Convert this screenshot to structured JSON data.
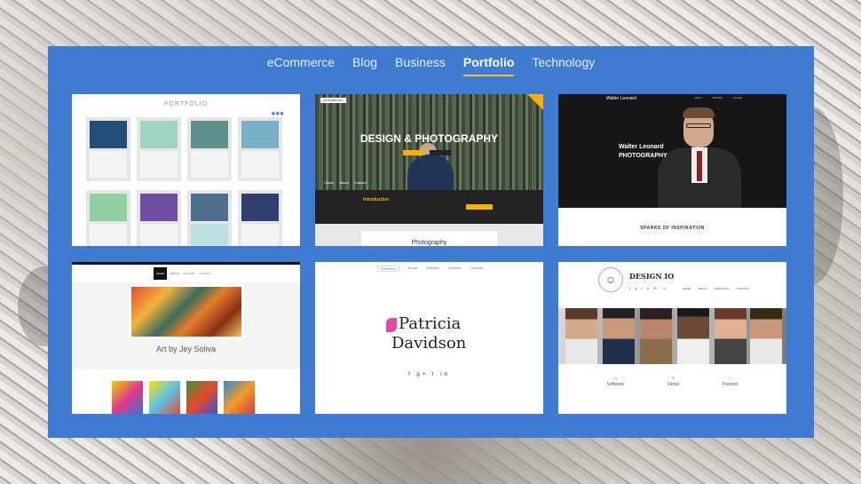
{
  "nav": {
    "tabs": [
      {
        "label": "eCommerce",
        "active": false
      },
      {
        "label": "Blog",
        "active": false
      },
      {
        "label": "Business",
        "active": false
      },
      {
        "label": "Portfolio",
        "active": true
      },
      {
        "label": "Technology",
        "active": false
      }
    ]
  },
  "colors": {
    "panel": "#3e7bd1",
    "active_underline": "#f2c230",
    "accent_yellow": "#f2b400"
  },
  "templates": [
    {
      "title": "PORTFOLIO"
    },
    {
      "title": "DESIGN & PHOTOGRAPHY",
      "tag": "MY PORTFOLIO",
      "menu": [
        "Cases",
        "About",
        "Contact"
      ],
      "intro": "Introduction",
      "footer": "Photography"
    },
    {
      "brand": "Walter Leonard",
      "headline_1": "Walter Leonard",
      "headline_2": "PHOTOGRAPHY",
      "menu": [
        "Home",
        "Portfolio",
        "Contact"
      ],
      "section": "SPARKS OF INSPIRATION"
    },
    {
      "menu": [
        "HOME",
        "ABOUT",
        "GALLERY",
        "CONTACT"
      ],
      "title": "Art by Jey Soliva"
    },
    {
      "menu": [
        "Overview",
        "About",
        "Portfolio",
        "Services",
        "Contact"
      ],
      "name_1": "Patricia",
      "name_2": "Davidson",
      "social": "f g+ t in"
    },
    {
      "brand": "DESIGN IO",
      "icons": "f g t p ✉ in",
      "menu": [
        "HOME",
        "ABOUT",
        "PORTFOLIO",
        "CONTACT"
      ],
      "features": [
        "Software",
        "Detail",
        "Passion"
      ]
    }
  ]
}
